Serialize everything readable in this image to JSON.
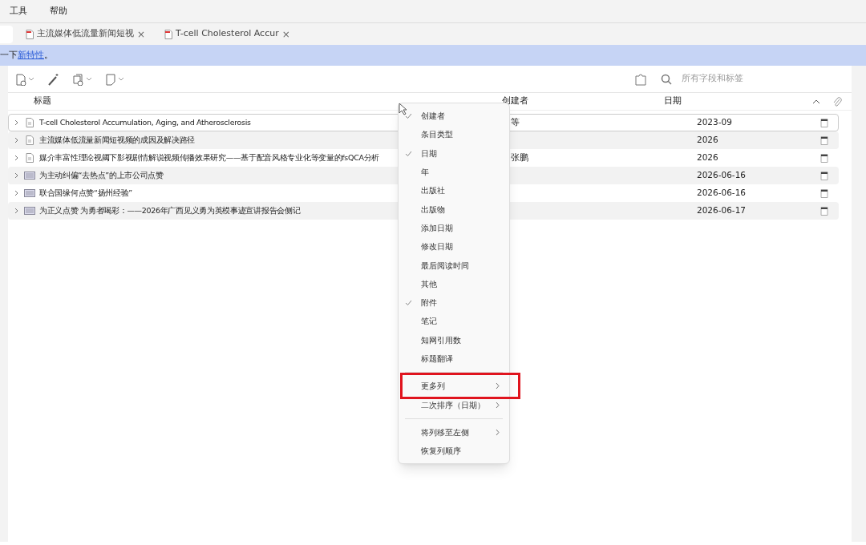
{
  "menubar": [
    "工具",
    "帮助"
  ],
  "tabs": [
    {
      "title": "主流媒体低流量新闻短视",
      "close": "×",
      "selected": false
    },
    {
      "title": "T-cell Cholesterol Accur",
      "close": "×",
      "selected": false
    }
  ],
  "banner": {
    "prefix": "一下",
    "link": "新特性",
    "suffix": "。"
  },
  "search": {
    "placeholder": "所有字段和标签"
  },
  "columns": {
    "title": "标题",
    "creator": "创建者",
    "date": "日期"
  },
  "rows": [
    {
      "kind": "document",
      "title": "T-cell Cholesterol Accumulation, Aging, and Atherosclerosis",
      "creator": "等",
      "date": "2023-09",
      "selected": true
    },
    {
      "kind": "document",
      "title": "主流媒体低流量新闻短视频的成因及解决路径",
      "creator": "",
      "date": "2026",
      "selected": false
    },
    {
      "kind": "document",
      "title": "媒介丰富性理论视阈下影视剧情解说视频传播效果研究——基于配音风格专业化等变量的fsQCA分析",
      "creator": "张鹏",
      "date": "2026",
      "selected": false
    },
    {
      "kind": "newspaper",
      "title": "为主动纠偏“去热点”的上市公司点赞",
      "creator": "",
      "date": "2026-06-16",
      "selected": false
    },
    {
      "kind": "newspaper",
      "title": "联合国缘何点赞“扬州经验”",
      "creator": "",
      "date": "2026-06-16",
      "selected": false
    },
    {
      "kind": "newspaper",
      "title": "为正义点赞 为勇者喝彩：——2026年广西见义勇为英模事迹宣讲报告会侧记",
      "creator": "",
      "date": "2026-06-17",
      "selected": false
    }
  ],
  "context_menu": [
    {
      "kind": "check",
      "label": "创建者",
      "checked": true
    },
    {
      "kind": "check",
      "label": "条目类型",
      "checked": false
    },
    {
      "kind": "check",
      "label": "日期",
      "checked": true
    },
    {
      "kind": "check",
      "label": "年",
      "checked": false
    },
    {
      "kind": "check",
      "label": "出版社",
      "checked": false
    },
    {
      "kind": "check",
      "label": "出版物",
      "checked": false
    },
    {
      "kind": "check",
      "label": "添加日期",
      "checked": false
    },
    {
      "kind": "check",
      "label": "修改日期",
      "checked": false
    },
    {
      "kind": "check",
      "label": "最后阅读时间",
      "checked": false
    },
    {
      "kind": "check",
      "label": "其他",
      "checked": false
    },
    {
      "kind": "check",
      "label": "附件",
      "checked": true
    },
    {
      "kind": "check",
      "label": "笔记",
      "checked": false
    },
    {
      "kind": "check",
      "label": "知网引用数",
      "checked": false
    },
    {
      "kind": "check",
      "label": "标题翻译",
      "checked": false
    },
    {
      "kind": "separator"
    },
    {
      "kind": "submenu",
      "label": "更多列",
      "highlighted": true
    },
    {
      "kind": "submenu",
      "label": "二次排序（日期）",
      "highlighted": false
    },
    {
      "kind": "separator"
    },
    {
      "kind": "submenu",
      "label": "将列移至左侧",
      "highlighted": false
    },
    {
      "kind": "action",
      "label": "恢复列顺序"
    }
  ]
}
